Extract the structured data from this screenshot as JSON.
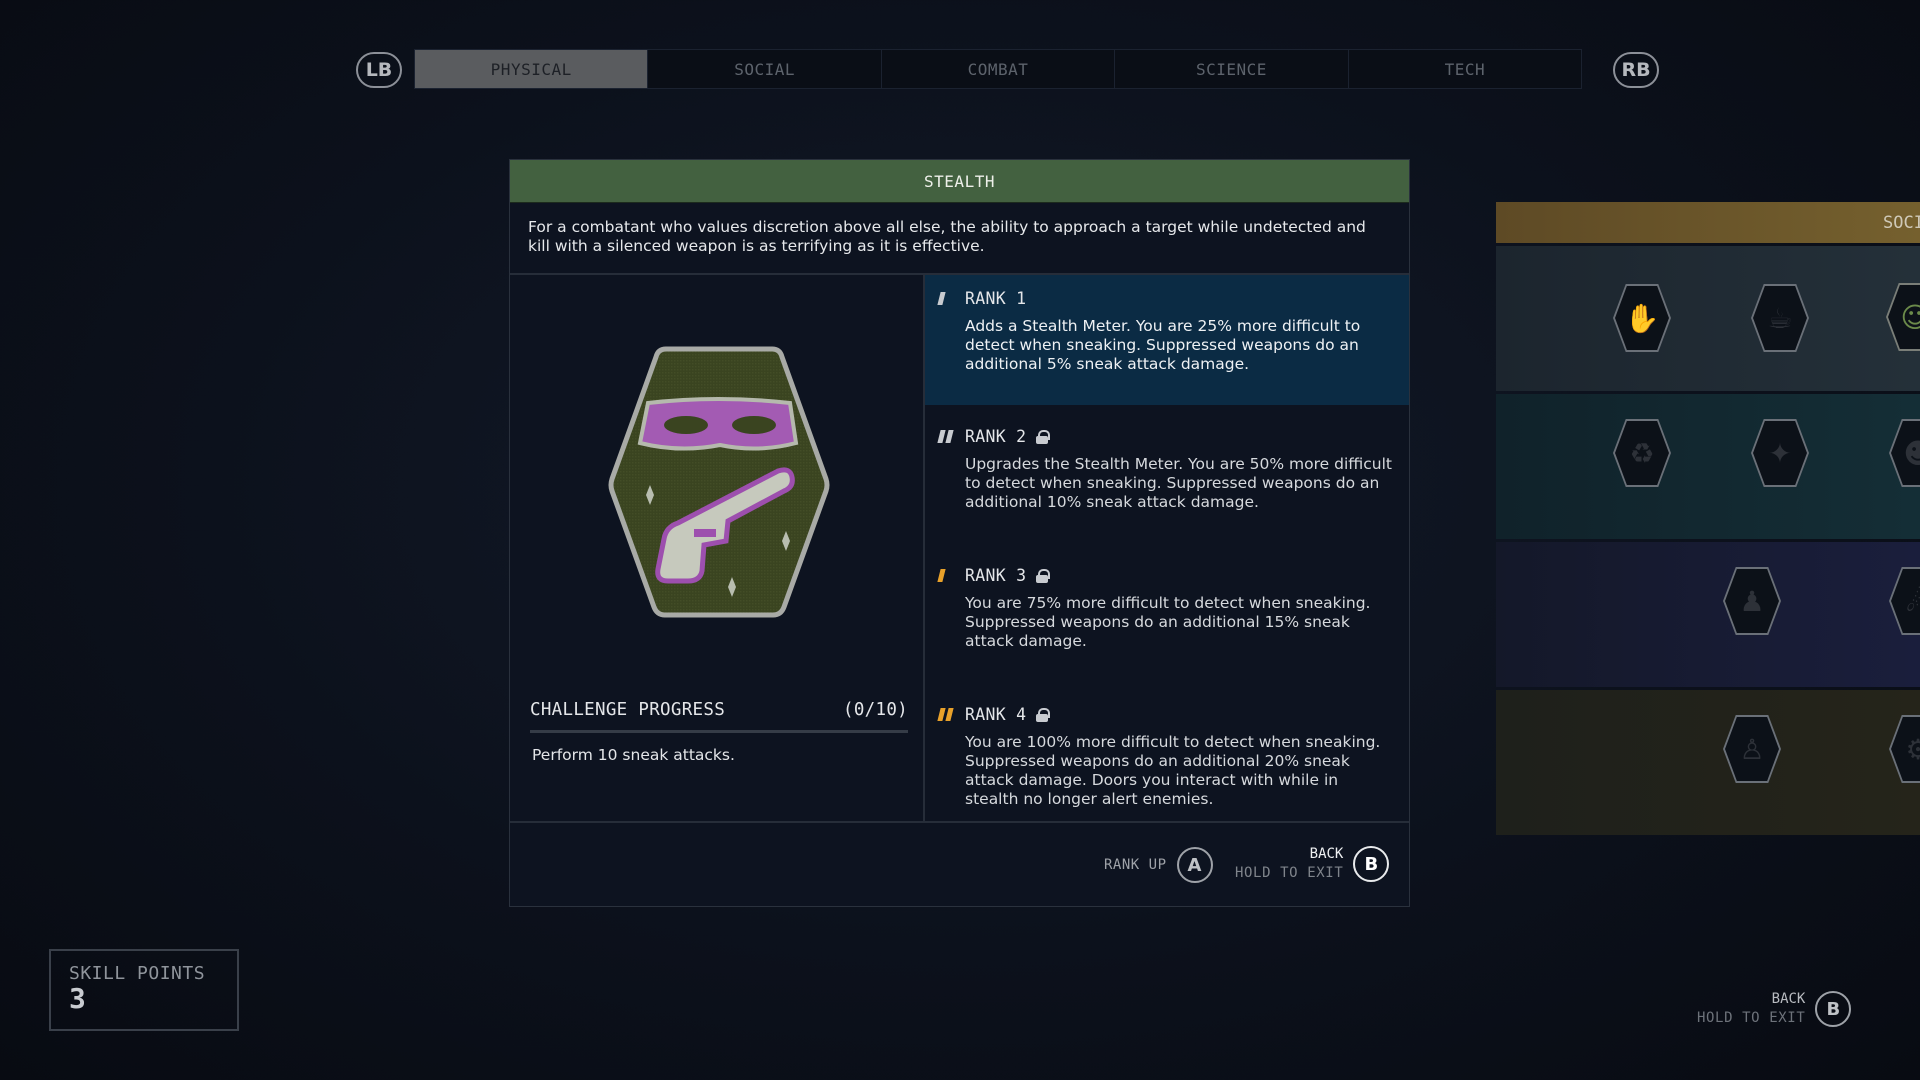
{
  "nav": {
    "left_bumper": "LB",
    "right_bumper": "RB",
    "tabs": [
      {
        "label": "PHYSICAL",
        "active": true
      },
      {
        "label": "SOCIAL",
        "active": false
      },
      {
        "label": "COMBAT",
        "active": false
      },
      {
        "label": "SCIENCE",
        "active": false
      },
      {
        "label": "TECH",
        "active": false
      }
    ]
  },
  "skill": {
    "name": "STEALTH",
    "header_color": "#436140",
    "description": "For a combatant who values discretion above all else, the ability to approach a target while undetected and kill with a silenced weapon is as terrifying as it is effective.",
    "badge_icon": "stealth-mask-pistol-patch",
    "challenge": {
      "title": "CHALLENGE PROGRESS",
      "progress_text": "(0/10)",
      "current": 0,
      "total": 10,
      "description": "Perform 10 sneak attacks."
    },
    "ranks": [
      {
        "label": "RANK 1",
        "locked": false,
        "active": true,
        "marker_color": "#c8cbd0",
        "marker_count": 1,
        "description": "Adds a Stealth Meter. You are 25% more difficult to detect when sneaking. Suppressed weapons do an additional 5% sneak attack damage."
      },
      {
        "label": "RANK 2",
        "locked": true,
        "active": false,
        "marker_color": "#c8cbd0",
        "marker_count": 2,
        "description": "Upgrades the Stealth Meter. You are 50% more difficult to detect when sneaking. Suppressed weapons do an additional 10% sneak attack damage."
      },
      {
        "label": "RANK 3",
        "locked": true,
        "active": false,
        "marker_color": "#e8a12a",
        "marker_count": 1,
        "description": "You are 75% more difficult to detect when sneaking. Suppressed weapons do an additional 15% sneak attack damage."
      },
      {
        "label": "RANK 4",
        "locked": true,
        "active": false,
        "marker_color": "#e8a12a",
        "marker_count": 2,
        "description": "You are 100% more difficult to detect when sneaking. Suppressed weapons do an additional 20% sneak attack damage. Doors you interact with while in stealth no longer alert enemies."
      }
    ]
  },
  "footer": {
    "rank_up_label": "RANK UP",
    "rank_up_button": "A",
    "back_label": "BACK",
    "hold_label": "HOLD TO EXIT",
    "back_button": "B"
  },
  "side_panel": {
    "title": "SOCI",
    "rows": [
      {
        "color": "#1f2a33",
        "icons": [
          "hand-holding-card-icon",
          "hand-holding-food-icon",
          "face-speaking-sparkles-icon"
        ]
      },
      {
        "color": "#12262c",
        "icons": [
          "money-bag-gift-exchange-icon",
          "handshake-planets-icon",
          "angry-ape-face-icon"
        ]
      },
      {
        "color": "#171a33",
        "icons": [
          "hand-bribe-people-icon",
          "astronaut-crew-icon"
        ]
      },
      {
        "color": "#21221a",
        "icons": [
          "puppet-strings-icon",
          "robot-arm-icon"
        ]
      }
    ]
  },
  "skill_points": {
    "label": "SKILL POINTS",
    "value": "3"
  },
  "global_back": {
    "back_label": "BACK",
    "hold_label": "HOLD TO EXIT",
    "button": "B"
  }
}
